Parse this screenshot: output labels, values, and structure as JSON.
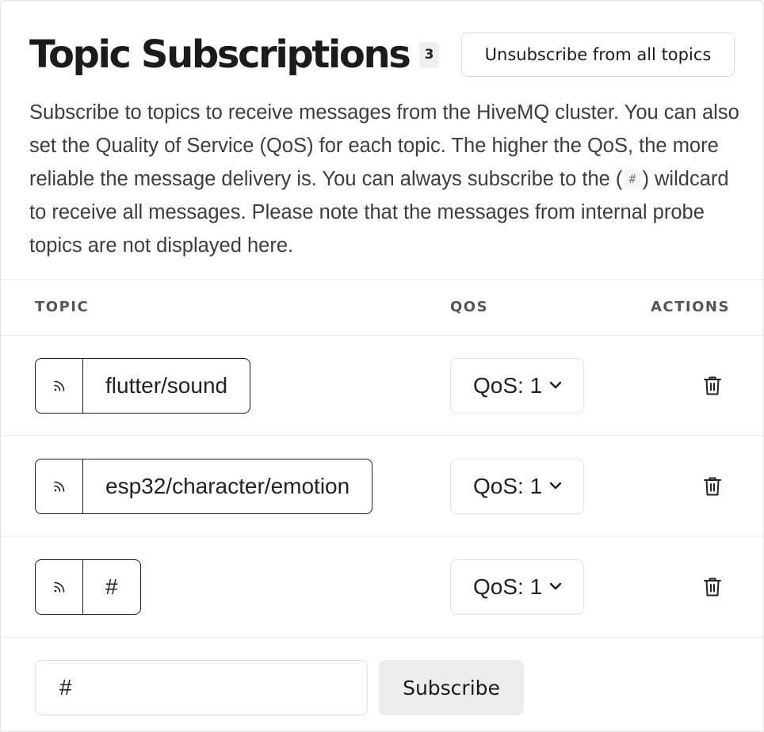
{
  "header": {
    "title": "Topic Subscriptions",
    "count": "3",
    "unsubscribe_all_label": "Unsubscribe from all topics"
  },
  "description": {
    "part1": "Subscribe to topics to receive messages from the HiveMQ cluster. You can also set the Quality of Service (QoS) for each topic. The higher the QoS, the more reliable the message delivery is. You can always subscribe to the (",
    "wildcard": "#",
    "part2": ") wildcard to receive all messages. Please note that the messages from internal probe topics are not displayed here."
  },
  "table": {
    "headers": {
      "topic": "TOPIC",
      "qos": "QOS",
      "actions": "ACTIONS"
    },
    "rows": [
      {
        "topic": "flutter/sound",
        "qos": "QoS: 1",
        "icon": "rss-feed-icon",
        "action_icon": "trash-icon"
      },
      {
        "topic": "esp32/character/emotion",
        "qos": "QoS: 1",
        "icon": "rss-feed-icon",
        "action_icon": "trash-icon"
      },
      {
        "topic": "#",
        "qos": "QoS: 1",
        "icon": "rss-feed-icon",
        "action_icon": "trash-icon"
      }
    ]
  },
  "new_subscription": {
    "value": "#",
    "button_label": "Subscribe"
  }
}
